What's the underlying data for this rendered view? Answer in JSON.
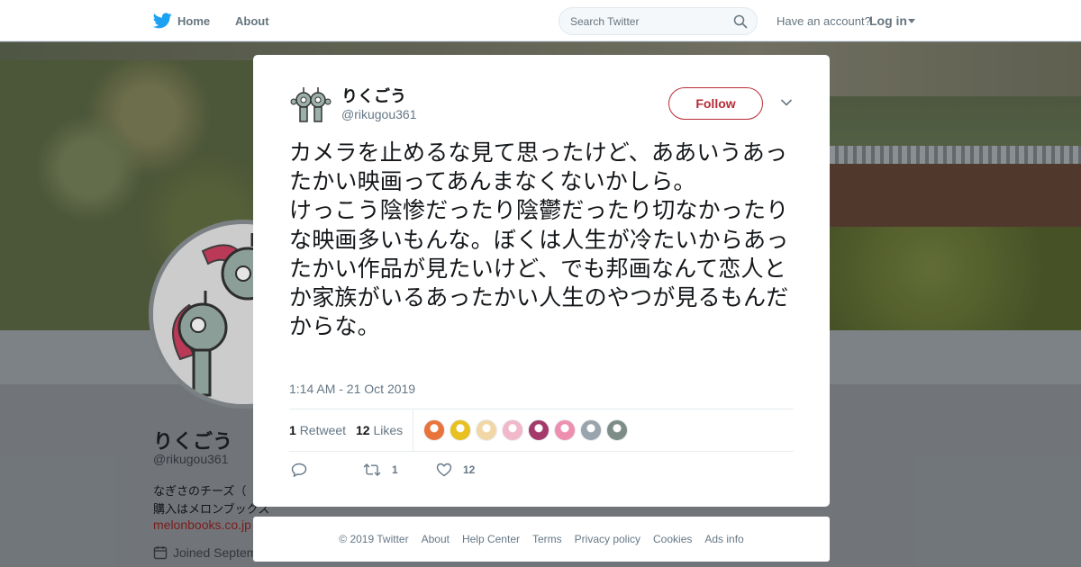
{
  "nav": {
    "home_label": "Home",
    "about_label": "About",
    "search_placeholder": "Search Twitter",
    "account_prompt": "Have an account?",
    "login_label": "Log in"
  },
  "profile": {
    "name": "りくごう",
    "handle": "@rikugou361",
    "bio_line1": "なぎさのチーズ（",
    "bio_line2": "購入はメロンブックス",
    "link": "melonbooks.co.jp",
    "joined": "Joined Septem"
  },
  "tweet": {
    "author_name": "りくごう",
    "author_handle": "@rikugou361",
    "follow_label": "Follow",
    "text": "カメラを止めるな見て思ったけど、ああいうあったかい映画ってあんまなくないかしら。\nけっこう陰惨だったり陰鬱だったり切なかったりな映画多いもんな。ぼくは人生が冷たいからあったかい作品が見たいけど、でも邦画なんて恋人とか家族がいるあったかい人生のやつが見るもんだからな。",
    "timestamp": "1:14 AM - 21 Oct 2019",
    "retweet_count": "1",
    "retweet_label": "Retweet",
    "like_count": "12",
    "like_label": "Likes",
    "action_retweet_count": "1",
    "action_like_count": "12",
    "liker_colors": [
      "#e8743b",
      "#e8c020",
      "#f2d7a6",
      "#f0b8c8",
      "#a33a6a",
      "#ef8fb0",
      "#9aa4ad",
      "#7d8c86"
    ]
  },
  "footer": {
    "copyright": "© 2019 Twitter",
    "links": [
      "About",
      "Help Center",
      "Terms",
      "Privacy policy",
      "Cookies",
      "Ads info"
    ]
  },
  "colors": {
    "brand_blue": "#1da1f2",
    "follow_accent": "#b82a36",
    "link_red": "#8a1f1f"
  },
  "icons": [
    "twitter-bird-icon",
    "search-icon",
    "login-caret-icon",
    "close-icon",
    "chevron-down-icon",
    "reply-icon",
    "retweet-icon",
    "like-heart-icon",
    "calendar-icon"
  ]
}
